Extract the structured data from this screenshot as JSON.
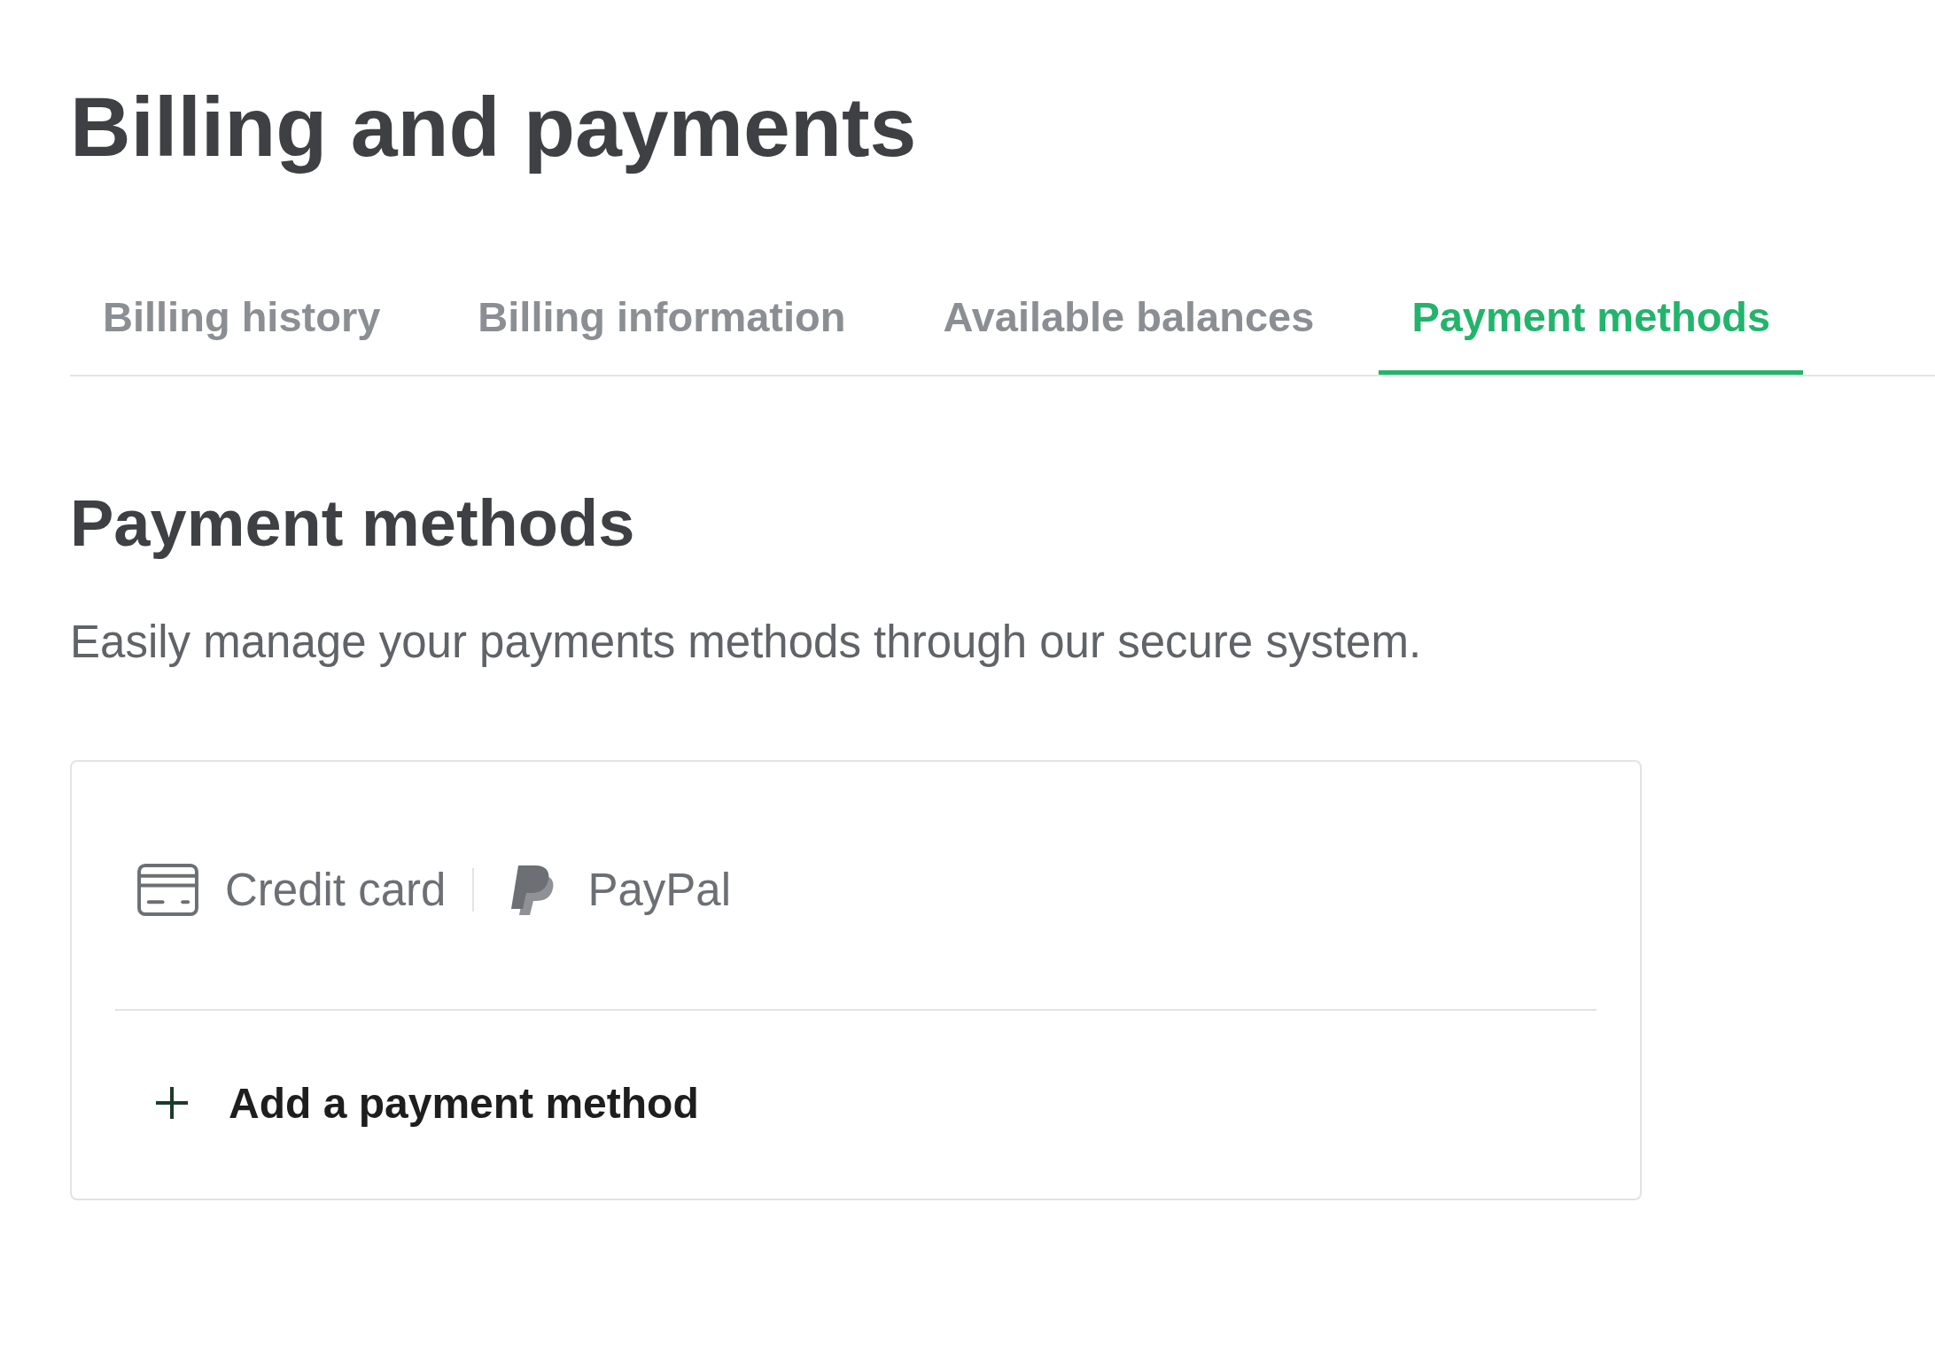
{
  "page": {
    "title": "Billing and payments"
  },
  "tabs": [
    {
      "label": "Billing history",
      "selected": false
    },
    {
      "label": "Billing information",
      "selected": false
    },
    {
      "label": "Available balances",
      "selected": false
    },
    {
      "label": "Payment methods",
      "selected": true
    }
  ],
  "section": {
    "heading": "Payment methods",
    "description": "Easily manage your payments methods through our secure system."
  },
  "payment_card": {
    "options": [
      {
        "kind": "card",
        "label": "Credit card"
      },
      {
        "kind": "paypal",
        "label": "PayPal"
      }
    ],
    "add_button": {
      "label": "Add a payment method"
    }
  }
}
